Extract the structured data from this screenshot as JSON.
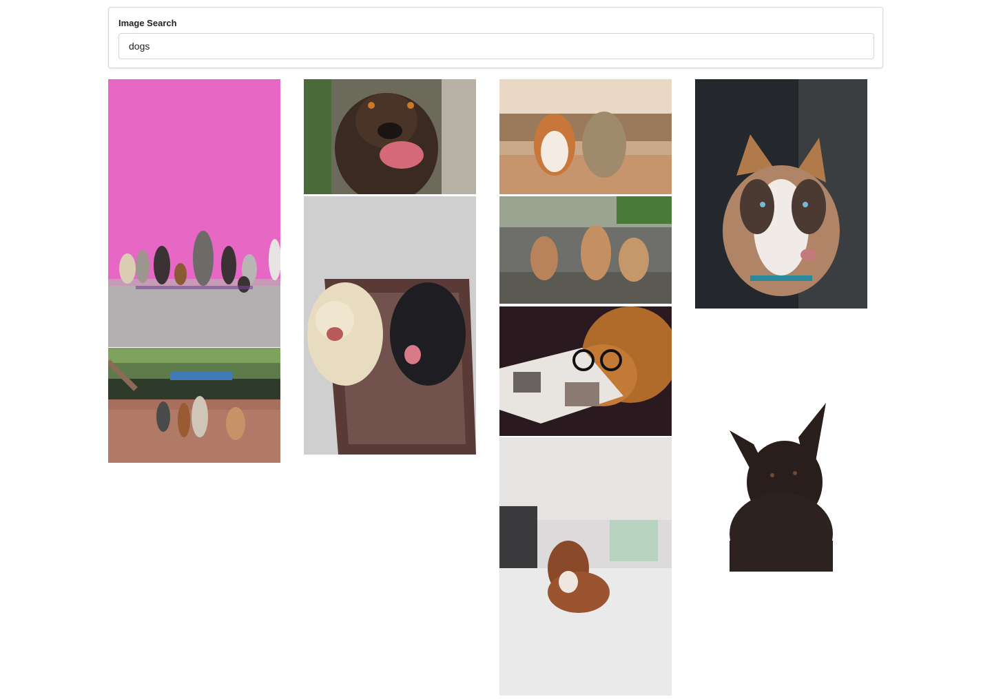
{
  "search": {
    "label": "Image Search",
    "value": "dogs",
    "placeholder": ""
  },
  "results": [
    {
      "subject": "dogs-sitting-by-pink-wall",
      "column": 1
    },
    {
      "subject": "dogs-on-leash-in-park",
      "column": 1
    },
    {
      "subject": "brown-dog-licking-nose",
      "column": 2
    },
    {
      "subject": "two-dogs-on-rug",
      "column": 2
    },
    {
      "subject": "corgi-and-terrier-running",
      "column": 3
    },
    {
      "subject": "three-puppies-on-road",
      "column": 3
    },
    {
      "subject": "dog-with-glasses-reading",
      "column": 3
    },
    {
      "subject": "puppy-on-bed",
      "column": 3
    },
    {
      "subject": "husky-portrait",
      "column": 4
    },
    {
      "subject": "black-dog-white-background",
      "column": 4
    }
  ],
  "colors": {
    "border": "#d8d8d8",
    "text": "#222222",
    "pink_wall": "#e667c4"
  }
}
